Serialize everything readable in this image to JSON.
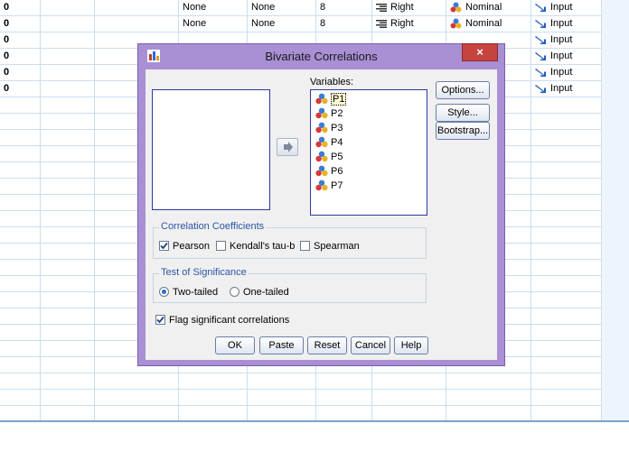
{
  "grid_rows": [
    {
      "c0": "0",
      "c3": "None",
      "c4": "None",
      "c5": "8",
      "c6": "Right",
      "c7": "Nominal",
      "c8": "Input"
    },
    {
      "c0": "0",
      "c3": "None",
      "c4": "None",
      "c5": "8",
      "c6": "Right",
      "c7": "Nominal",
      "c8": "Input"
    },
    {
      "c0": "0",
      "c8": "Input"
    },
    {
      "c0": "0",
      "c8": "Input"
    },
    {
      "c0": "0",
      "c8": "Input"
    },
    {
      "c0": "0",
      "c8": "Input"
    }
  ],
  "dialog": {
    "title": "Bivariate Correlations",
    "close_label": "×",
    "variables_label": "Variables:",
    "variables": [
      "P1",
      "P2",
      "P3",
      "P4",
      "P5",
      "P6",
      "P7"
    ],
    "side_buttons": {
      "options": "Options...",
      "style": "Style...",
      "bootstrap": "Bootstrap..."
    },
    "coefficients": {
      "title": "Correlation Coefficients",
      "pearson": {
        "label": "Pearson",
        "checked": true
      },
      "kendall": {
        "label": "Kendall's tau-b",
        "checked": false
      },
      "spearman": {
        "label": "Spearman",
        "checked": false
      }
    },
    "significance": {
      "title": "Test of Significance",
      "two_tailed": {
        "label": "Two-tailed",
        "selected": true
      },
      "one_tailed": {
        "label": "One-tailed",
        "selected": false
      }
    },
    "flag": {
      "label": "Flag significant correlations",
      "checked": true
    },
    "buttons": {
      "ok": "OK",
      "paste": "Paste",
      "reset": "Reset",
      "cancel": "Cancel",
      "help": "Help"
    }
  },
  "colors": {
    "title_bar": "#a98fd3",
    "close": "#c7433f",
    "accent": "#2b55a6"
  }
}
